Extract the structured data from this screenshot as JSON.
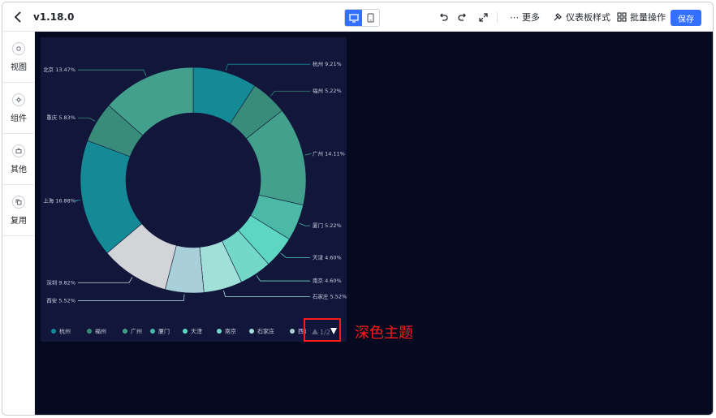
{
  "topbar": {
    "version": "v1.18.0",
    "more_label": "更多",
    "theme_label": "仪表板样式",
    "batch_label": "批量操作",
    "save_label": "保存"
  },
  "sidebar": {
    "items": [
      {
        "label": "视图"
      },
      {
        "label": "组件"
      },
      {
        "label": "其他"
      },
      {
        "label": "复用"
      }
    ]
  },
  "chart_data": {
    "type": "pie",
    "variant": "donut",
    "categories": [
      "杭州",
      "福州",
      "广州",
      "厦门",
      "天津",
      "南京",
      "石家庄",
      "西安",
      "深圳",
      "上海",
      "重庆",
      "北京"
    ],
    "values": [
      9.21,
      5.22,
      14.11,
      5.22,
      4.6,
      4.6,
      5.52,
      5.52,
      9.82,
      16.88,
      5.83,
      13.47
    ],
    "labels": [
      "杭州 9.21%",
      "福州 5.22%",
      "广州 14.11%",
      "厦门 5.22%",
      "天津 4.60%",
      "南京 4.60%",
      "石家庄 5.52%",
      "西安 5.52%",
      "深圳 9.82%",
      "上海 16.88%",
      "重庆 5.83%",
      "北京 13.47%"
    ],
    "colors": [
      "#148a96",
      "#3a8c7a",
      "#42a08c",
      "#4cb9a6",
      "#5dd6c2",
      "#74d8c8",
      "#a0e0d8",
      "#a9cfd8",
      "#d3d4d8",
      "#148a96",
      "#3a8c7a",
      "#42a08c"
    ],
    "legend": {
      "placement": "bottom",
      "visible_items": [
        "杭州",
        "福州",
        "广州",
        "厦门",
        "天津",
        "南京",
        "石家庄",
        "西安"
      ],
      "page": "1/2"
    }
  },
  "annotation": {
    "text": "深色主题",
    "color": "#ff1a1a"
  },
  "colors": {
    "accent": "#3370ff",
    "canvas_bg": "#050a21",
    "card_bg": "#11163a"
  },
  "icons": {
    "back": "chevron-left-icon",
    "desktop": "desktop-icon",
    "mobile": "mobile-icon",
    "undo": "undo-icon",
    "redo": "redo-icon",
    "fullscreen": "expand-icon",
    "more": "ellipsis-icon",
    "theme": "style-icon",
    "batch": "grid-icon"
  }
}
